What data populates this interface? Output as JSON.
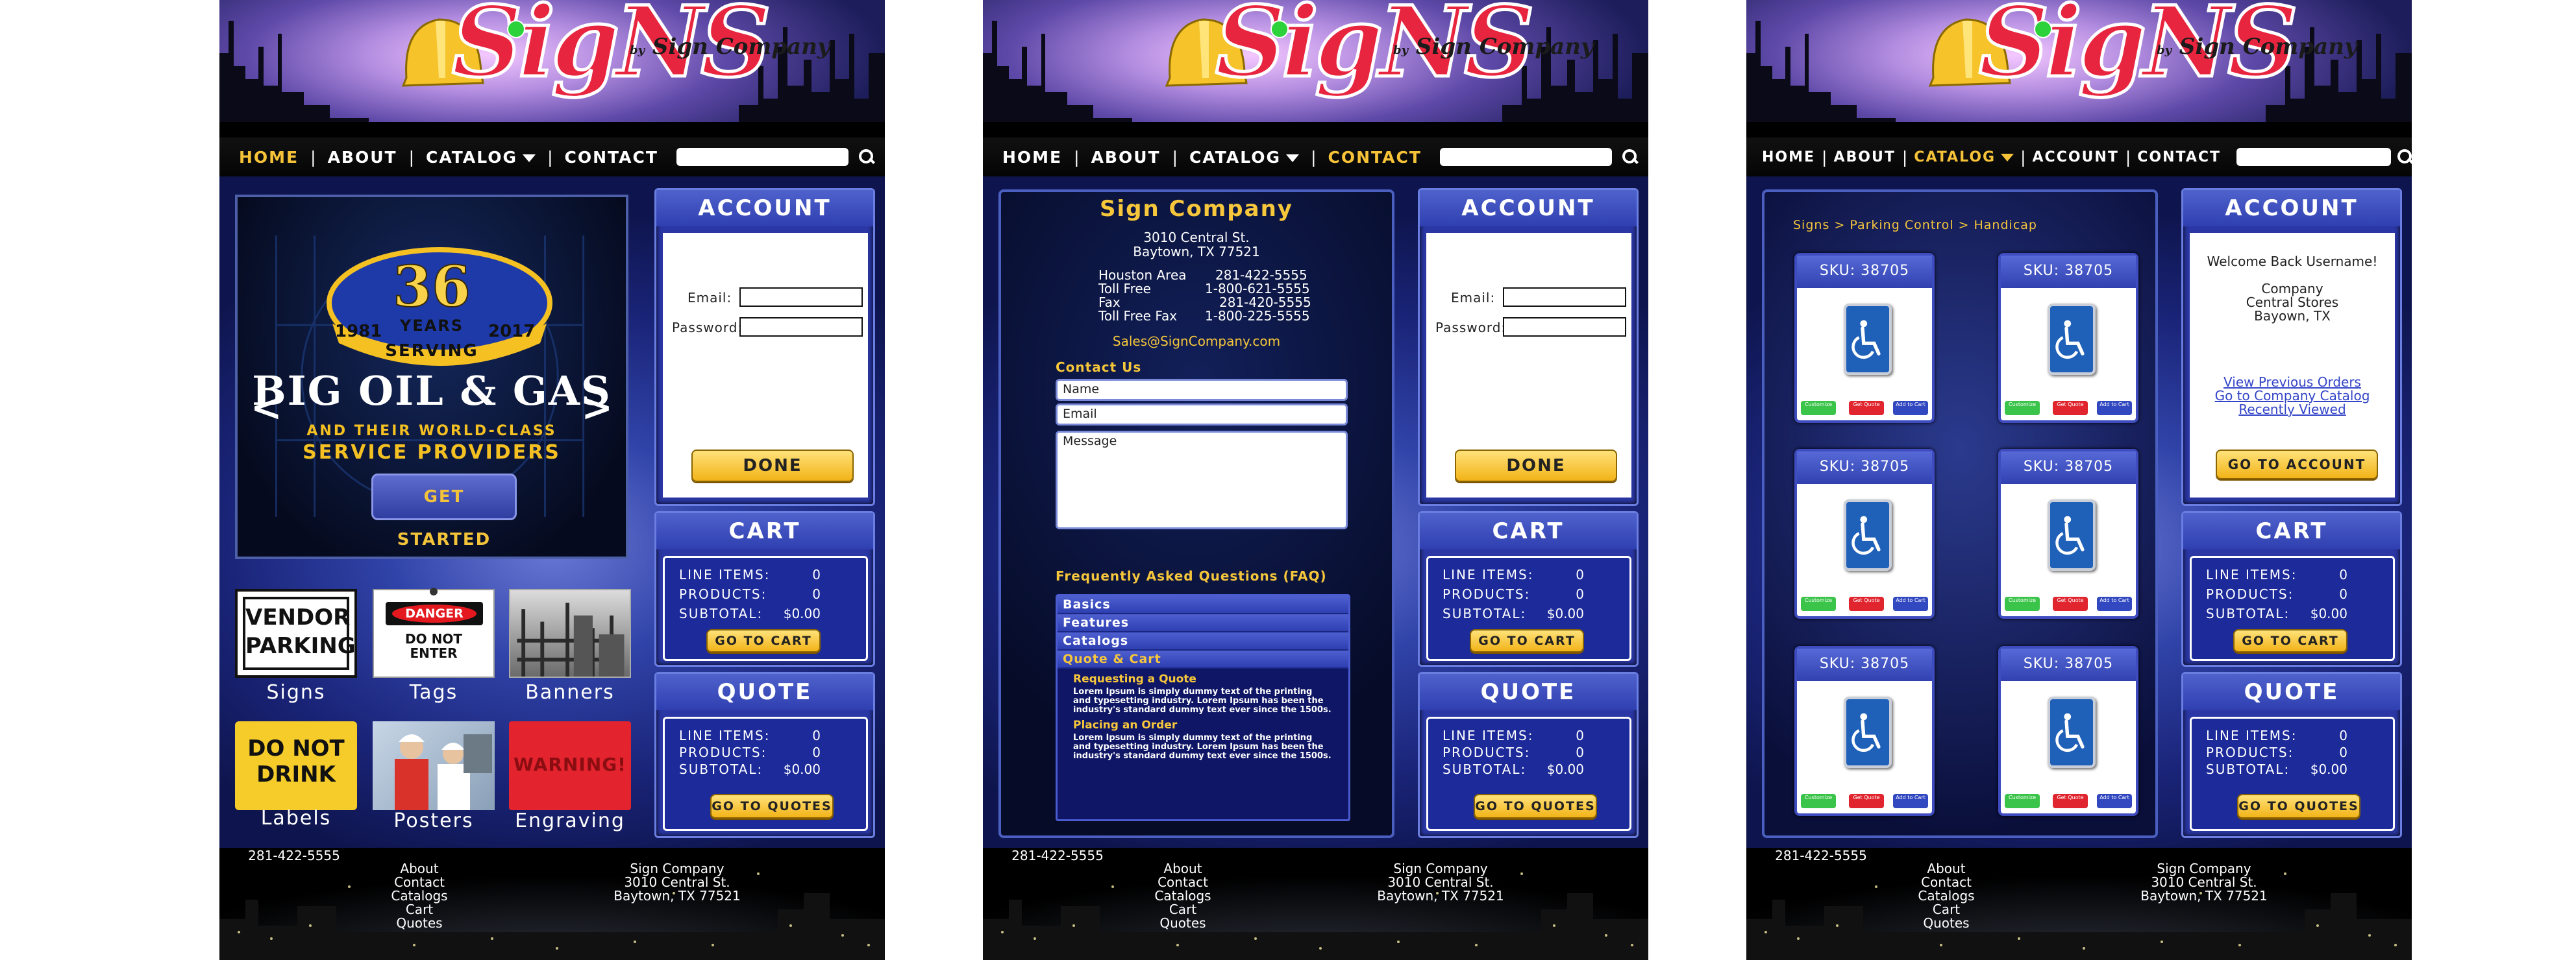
{
  "brand": {
    "logo_text": "SigNS",
    "logo_by": "by",
    "logo_company": "Sign Company"
  },
  "nav": {
    "home": "HOME",
    "about": "ABOUT",
    "catalog": "CATALOG",
    "contact": "CONTACT",
    "account": "ACCOUNT",
    "separator": "|"
  },
  "account_panel": {
    "title": "ACCOUNT",
    "email_label": "Email:",
    "password_label": "Password:",
    "done_button": "DONE"
  },
  "cart_panel": {
    "title": "CART",
    "rows": [
      {
        "label": "LINE ITEMS:",
        "value": "0"
      },
      {
        "label": "PRODUCTS:",
        "value": "0"
      },
      {
        "label": "SUBTOTAL:",
        "value": "$0.00"
      }
    ],
    "button": "GO TO CART"
  },
  "quote_panel": {
    "title": "QUOTE",
    "rows": [
      {
        "label": "LINE ITEMS:",
        "value": "0"
      },
      {
        "label": "PRODUCTS:",
        "value": "0"
      },
      {
        "label": "SUBTOTAL:",
        "value": "$0.00"
      }
    ],
    "button": "GO TO QUOTES"
  },
  "footer": {
    "links": "About\nContact\nCatalogs\nCart\nQuotes",
    "address": "Sign Company\n3010 Central St.\nBaytown, TX 77521",
    "phone": "281-422-5555"
  },
  "home": {
    "slider": {
      "prev": "<",
      "next": ">",
      "badge_number": "36",
      "badge_years": "YEARS",
      "badge_from": "1981",
      "badge_to": "2017",
      "badge_serving": "SERVING",
      "headline": "BIG OIL & GAS",
      "tagline_1": "AND THEIR WORLD-CLASS",
      "tagline_2": "SERVICE PROVIDERS",
      "cta": "GET STARTED"
    },
    "categories": [
      {
        "name": "Signs",
        "art": "VENDOR\nPARKING"
      },
      {
        "name": "Tags",
        "art_top": "DANGER",
        "art": "DO NOT\nENTER"
      },
      {
        "name": "Banners"
      },
      {
        "name": "Labels",
        "art": "DO NOT\nDRINK"
      },
      {
        "name": "Posters"
      },
      {
        "name": "Engraving",
        "art": "WARNING!"
      }
    ]
  },
  "contact": {
    "company": "Sign Company",
    "street": "3010 Central St.",
    "city": "Baytown, TX 77521",
    "phones": [
      {
        "label": "Houston Area",
        "number": "281-422-5555"
      },
      {
        "label": "Toll Free",
        "number": "1-800-621-5555"
      },
      {
        "label": "Fax",
        "number": "281-420-5555"
      },
      {
        "label": "Toll Free Fax",
        "number": "1-800-225-5555"
      }
    ],
    "email": "Sales@SignCompany.com",
    "contact_heading": "Contact Us",
    "name_placeholder": "Name",
    "email_placeholder": "Email",
    "message_placeholder": "Message",
    "faq_heading": "Frequently Asked Questions (FAQ)",
    "faq_items": [
      "Basics",
      "Features",
      "Catalogs",
      "Quote & Cart"
    ],
    "faq_sub1": "Requesting a Quote",
    "faq_text1": "Lorem Ipsum is simply dummy text of the printing and typesetting industry. Lorem Ipsum has been the industry's standard dummy text ever since the 1500s.",
    "faq_sub2": "Placing an Order",
    "faq_text2": "Lorem Ipsum is simply dummy text of the printing and typesetting industry. Lorem Ipsum has been the industry's standard dummy text ever since the 1500s."
  },
  "catalog": {
    "breadcrumb": "Signs > Parking Control > Handicap",
    "sku_label": "SKU: 38705",
    "btn_customize": "Customize",
    "btn_quote": "Get Quote",
    "btn_cart": "Add to Cart",
    "account": {
      "welcome": "Welcome Back Username!",
      "company": "Company",
      "store": "Central Stores",
      "city": "Bayown, TX",
      "link1": "View Previous Orders",
      "link2": "Go to Company Catalog",
      "link3": "Recently Viewed",
      "button": "GO TO ACCOUNT"
    }
  },
  "colors": {
    "gold": "#f6c63b",
    "navy": "#1c2a9a",
    "logo_red": "#e8253f"
  }
}
